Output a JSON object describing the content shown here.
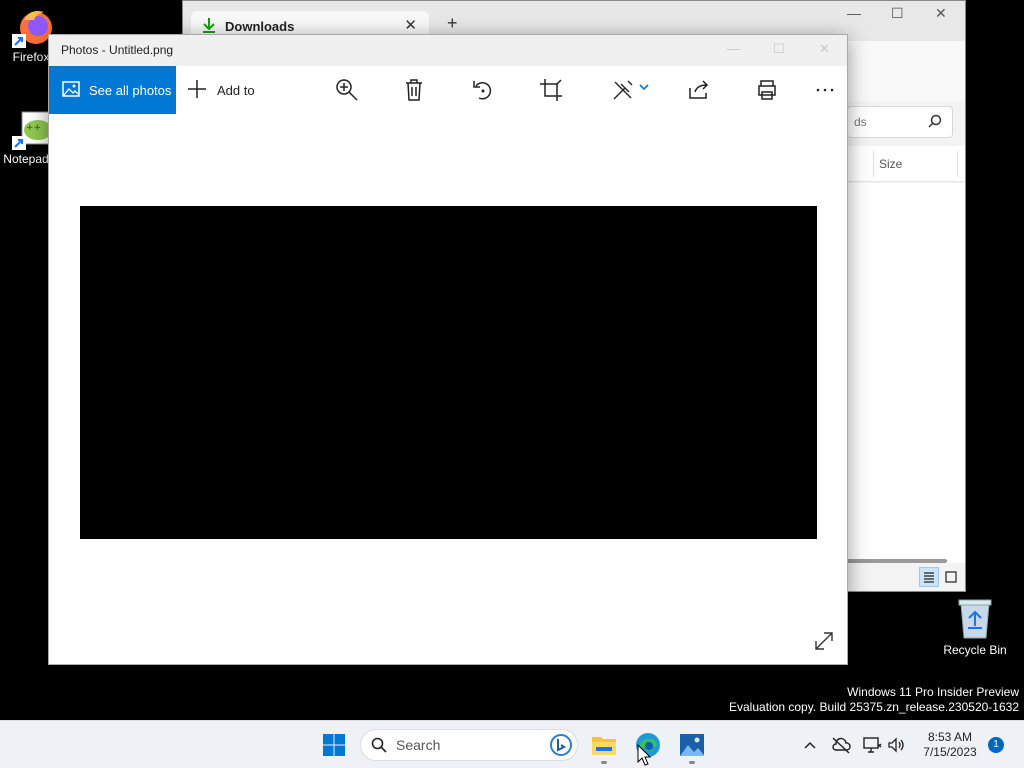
{
  "desktop": {
    "icons": [
      {
        "label": "Firefox"
      },
      {
        "label": "Notepad++"
      }
    ],
    "recycle_bin": {
      "label": "Recycle Bin"
    },
    "watermark": {
      "line1": "Windows 11 Pro Insider Preview",
      "line2": "Evaluation copy. Build 25375.zn_release.230520-1632"
    }
  },
  "explorer": {
    "tab_title": "Downloads",
    "search_placeholder_visible": "ds",
    "column_size": "Size"
  },
  "photos": {
    "title": "Photos - Untitled.png",
    "see_all_label": "See all photos",
    "add_to_label": "Add to"
  },
  "taskbar": {
    "search_label": "Search",
    "time": "8:53 AM",
    "date": "7/15/2023",
    "notification_count": "1"
  },
  "colors": {
    "accent": "#0078d4",
    "taskbar_bg": "#eef1f6"
  }
}
